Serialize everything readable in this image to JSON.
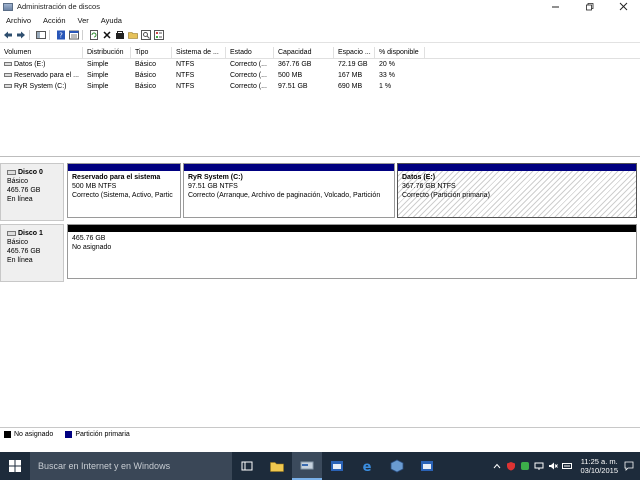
{
  "window": {
    "title": "Administración de discos"
  },
  "menu": [
    "Archivo",
    "Acción",
    "Ver",
    "Ayuda"
  ],
  "volume_list": {
    "columns": [
      "Volumen",
      "Distribución",
      "Tipo",
      "Sistema de ...",
      "Estado",
      "Capacidad",
      "Espacio ...",
      "% disponible"
    ],
    "rows": [
      [
        "Datos (E:)",
        "Simple",
        "Básico",
        "NTFS",
        "Correcto (...",
        "367.76 GB",
        "72.19 GB",
        "20 %"
      ],
      [
        "Reservado para el ...",
        "Simple",
        "Básico",
        "NTFS",
        "Correcto (...",
        "500 MB",
        "167 MB",
        "33 %"
      ],
      [
        "RyR System (C:)",
        "Simple",
        "Básico",
        "NTFS",
        "Correcto (...",
        "97.51 GB",
        "690 MB",
        "1 %"
      ]
    ]
  },
  "disks": [
    {
      "name": "Disco 0",
      "type": "Básico",
      "size": "465.76 GB",
      "status": "En línea",
      "partitions": [
        {
          "title": "Reservado para el sistema",
          "size": "500 MB NTFS",
          "status": "Correcto (Sistema, Activo, Partic"
        },
        {
          "title": "RyR System  (C:)",
          "size": "97.51 GB NTFS",
          "status": "Correcto (Arranque, Archivo de paginación, Volcado, Partición"
        },
        {
          "title": "Datos  (E:)",
          "size": "367.76 GB NTFS",
          "status": "Correcto (Partición primaria)"
        }
      ]
    },
    {
      "name": "Disco 1",
      "type": "Básico",
      "size": "465.76 GB",
      "status": "En línea",
      "partitions": [
        {
          "size": "465.76 GB",
          "status": "No asignado"
        }
      ]
    }
  ],
  "legend": [
    {
      "label": "No asignado",
      "color": "#000000"
    },
    {
      "label": "Partición primaria",
      "color": "#000080"
    }
  ],
  "colors": {
    "primary_partition": "#000080",
    "unallocated": "#000000"
  },
  "taskbar": {
    "search_placeholder": "Buscar en Internet y en Windows",
    "time": "11:25 a. m.",
    "date": "03/10/2015"
  }
}
